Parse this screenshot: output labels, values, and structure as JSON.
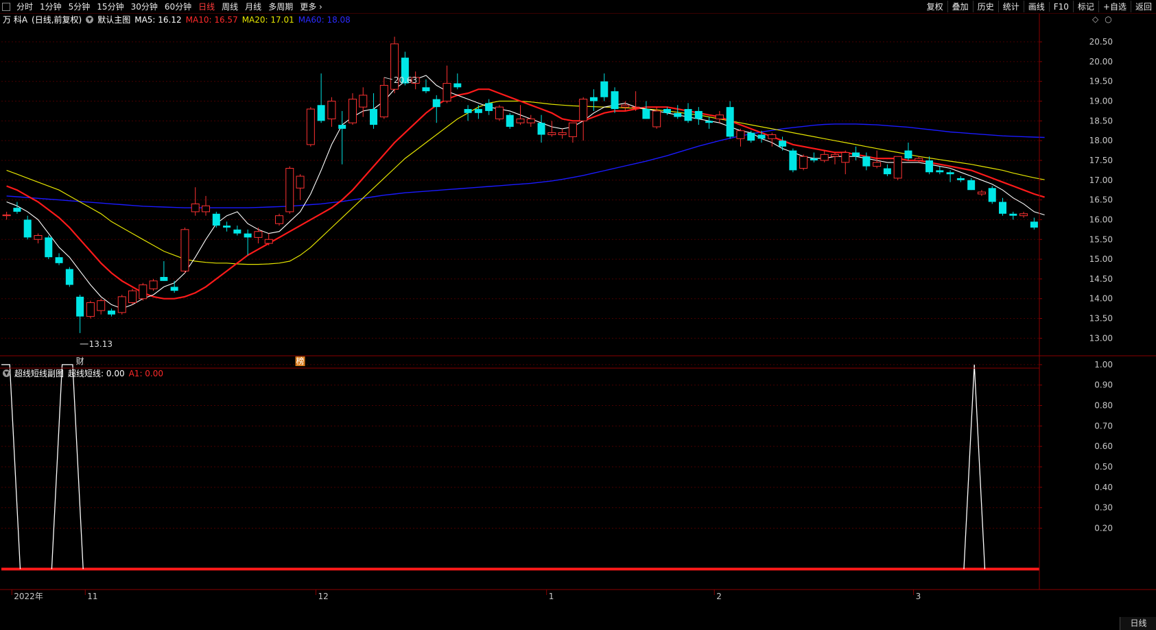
{
  "toolbar": {
    "tabs": [
      "分时",
      "1分钟",
      "5分钟",
      "15分钟",
      "30分钟",
      "60分钟",
      "日线",
      "周线",
      "月线",
      "多周期",
      "更多"
    ],
    "active_tab": "日线",
    "right_buttons": [
      "复权",
      "叠加",
      "历史",
      "统计",
      "画线",
      "F10",
      "标记",
      "+自选",
      "返回"
    ]
  },
  "main_info": {
    "stock": "万 科A",
    "mode": "(日线,前复权)",
    "chart_name": "默认主图",
    "ma5_label": "MA5: 16.12",
    "ma10_label": "MA10: 16.57",
    "ma20_label": "MA20: 17.01",
    "ma60_label": "MA60: 18.08"
  },
  "sub_info": {
    "name": "超线短线副图",
    "line_label": "超线短线: 0.00",
    "a1_label": "A1: 0.00"
  },
  "bottom_tab": "日线",
  "colors": {
    "up": "#ff3232",
    "down": "#00e6e6",
    "ma5": "#ffffff",
    "ma10": "#ff1a1a",
    "ma20": "#e6e600",
    "ma60": "#1a1aff",
    "grid": "#4a0000",
    "axis": "#8a0000"
  },
  "chart_data": {
    "type": "candlestick",
    "y_ticks": [
      20.5,
      20.0,
      19.5,
      19.0,
      18.5,
      18.0,
      17.5,
      17.0,
      16.5,
      16.0,
      15.5,
      15.0,
      14.5,
      14.0,
      13.5,
      13.0
    ],
    "y_tick_labels": [
      "20.50",
      "20.00",
      "19.50",
      "19.00",
      "18.50",
      "18.00",
      "17.50",
      "17.00",
      "16.50",
      "16.00",
      "15.50",
      "15.00",
      "14.50",
      "14.00",
      "13.50",
      "13.00"
    ],
    "ylim": [
      12.85,
      20.9
    ],
    "x_labels": [
      {
        "label": "2022年",
        "index": 1
      },
      {
        "label": "11",
        "index": 8
      },
      {
        "label": "12",
        "index": 30
      },
      {
        "label": "1",
        "index": 52
      },
      {
        "label": "2",
        "index": 68
      },
      {
        "label": "3",
        "index": 87
      }
    ],
    "annotations": {
      "high": "20.63",
      "low": "13.13",
      "high_index": 36,
      "low_index": 7,
      "marks": [
        {
          "text": "财",
          "index": 7
        },
        {
          "text": "榜",
          "index": 28
        }
      ]
    },
    "candles": [
      {
        "o": 16.1,
        "h": 16.2,
        "l": 16.0,
        "c": 16.12
      },
      {
        "o": 16.3,
        "h": 16.45,
        "l": 16.15,
        "c": 16.2
      },
      {
        "o": 16.0,
        "h": 16.1,
        "l": 15.5,
        "c": 15.55
      },
      {
        "o": 15.5,
        "h": 15.65,
        "l": 15.4,
        "c": 15.6
      },
      {
        "o": 15.55,
        "h": 15.6,
        "l": 15.0,
        "c": 15.05
      },
      {
        "o": 15.05,
        "h": 15.15,
        "l": 14.85,
        "c": 14.9
      },
      {
        "o": 14.75,
        "h": 14.8,
        "l": 14.3,
        "c": 14.35
      },
      {
        "o": 14.05,
        "h": 14.1,
        "l": 13.13,
        "c": 13.55
      },
      {
        "o": 13.55,
        "h": 13.95,
        "l": 13.5,
        "c": 13.9
      },
      {
        "o": 13.7,
        "h": 14.0,
        "l": 13.6,
        "c": 13.95
      },
      {
        "o": 13.7,
        "h": 13.75,
        "l": 13.55,
        "c": 13.6
      },
      {
        "o": 13.65,
        "h": 14.1,
        "l": 13.6,
        "c": 14.05
      },
      {
        "o": 13.9,
        "h": 14.25,
        "l": 13.85,
        "c": 14.2
      },
      {
        "o": 14.0,
        "h": 14.4,
        "l": 13.95,
        "c": 14.35
      },
      {
        "o": 14.25,
        "h": 14.5,
        "l": 14.2,
        "c": 14.45
      },
      {
        "o": 14.55,
        "h": 14.95,
        "l": 14.45,
        "c": 14.45
      },
      {
        "o": 14.3,
        "h": 14.45,
        "l": 14.15,
        "c": 14.2
      },
      {
        "o": 14.7,
        "h": 15.8,
        "l": 14.65,
        "c": 15.75
      },
      {
        "o": 16.2,
        "h": 16.82,
        "l": 16.1,
        "c": 16.4
      },
      {
        "o": 16.2,
        "h": 16.6,
        "l": 16.1,
        "c": 16.35
      },
      {
        "o": 16.15,
        "h": 16.2,
        "l": 15.8,
        "c": 15.85
      },
      {
        "o": 15.85,
        "h": 15.95,
        "l": 15.7,
        "c": 15.8
      },
      {
        "o": 15.75,
        "h": 15.85,
        "l": 15.6,
        "c": 15.65
      },
      {
        "o": 15.65,
        "h": 15.75,
        "l": 15.1,
        "c": 15.55
      },
      {
        "o": 15.55,
        "h": 15.8,
        "l": 15.4,
        "c": 15.7
      },
      {
        "o": 15.4,
        "h": 15.65,
        "l": 15.35,
        "c": 15.5
      },
      {
        "o": 15.9,
        "h": 16.15,
        "l": 15.85,
        "c": 16.1
      },
      {
        "o": 16.2,
        "h": 17.35,
        "l": 16.15,
        "c": 17.3
      },
      {
        "o": 16.8,
        "h": 17.15,
        "l": 16.5,
        "c": 17.1
      },
      {
        "o": 17.9,
        "h": 18.85,
        "l": 17.85,
        "c": 18.8
      },
      {
        "o": 18.9,
        "h": 19.7,
        "l": 18.45,
        "c": 18.5
      },
      {
        "o": 18.55,
        "h": 19.1,
        "l": 18.35,
        "c": 19.0
      },
      {
        "o": 18.4,
        "h": 18.75,
        "l": 17.4,
        "c": 18.3
      },
      {
        "o": 18.45,
        "h": 19.2,
        "l": 18.4,
        "c": 19.05
      },
      {
        "o": 18.85,
        "h": 19.35,
        "l": 18.6,
        "c": 19.15
      },
      {
        "o": 18.8,
        "h": 19.2,
        "l": 18.3,
        "c": 18.4
      },
      {
        "o": 18.6,
        "h": 19.6,
        "l": 18.55,
        "c": 19.4
      },
      {
        "o": 19.3,
        "h": 20.63,
        "l": 19.2,
        "c": 20.45
      },
      {
        "o": 20.1,
        "h": 20.25,
        "l": 19.4,
        "c": 19.45
      },
      {
        "o": 19.45,
        "h": 19.75,
        "l": 19.3,
        "c": 19.6
      },
      {
        "o": 19.35,
        "h": 19.55,
        "l": 19.2,
        "c": 19.25
      },
      {
        "o": 19.05,
        "h": 19.15,
        "l": 18.45,
        "c": 18.85
      },
      {
        "o": 19.0,
        "h": 19.9,
        "l": 18.95,
        "c": 19.45
      },
      {
        "o": 19.45,
        "h": 19.7,
        "l": 19.3,
        "c": 19.35
      },
      {
        "o": 18.8,
        "h": 18.9,
        "l": 18.5,
        "c": 18.7
      },
      {
        "o": 18.8,
        "h": 18.9,
        "l": 18.55,
        "c": 18.7
      },
      {
        "o": 18.95,
        "h": 19.05,
        "l": 18.65,
        "c": 18.75
      },
      {
        "o": 18.55,
        "h": 18.9,
        "l": 18.5,
        "c": 18.85
      },
      {
        "o": 18.65,
        "h": 18.7,
        "l": 18.3,
        "c": 18.35
      },
      {
        "o": 18.45,
        "h": 18.9,
        "l": 18.4,
        "c": 18.55
      },
      {
        "o": 18.45,
        "h": 18.65,
        "l": 18.35,
        "c": 18.55
      },
      {
        "o": 18.45,
        "h": 18.65,
        "l": 17.95,
        "c": 18.15
      },
      {
        "o": 18.15,
        "h": 18.5,
        "l": 18.1,
        "c": 18.2
      },
      {
        "o": 18.15,
        "h": 18.3,
        "l": 18.05,
        "c": 18.2
      },
      {
        "o": 18.1,
        "h": 18.45,
        "l": 17.95,
        "c": 18.45
      },
      {
        "o": 18.5,
        "h": 19.1,
        "l": 18.0,
        "c": 19.05
      },
      {
        "o": 19.1,
        "h": 19.3,
        "l": 18.75,
        "c": 19.0
      },
      {
        "o": 19.5,
        "h": 19.7,
        "l": 19.0,
        "c": 19.1
      },
      {
        "o": 19.25,
        "h": 19.35,
        "l": 18.7,
        "c": 18.8
      },
      {
        "o": 18.85,
        "h": 19.0,
        "l": 18.75,
        "c": 18.9
      },
      {
        "o": 18.85,
        "h": 19.25,
        "l": 18.75,
        "c": 18.85
      },
      {
        "o": 18.8,
        "h": 19.0,
        "l": 18.55,
        "c": 18.55
      },
      {
        "o": 18.35,
        "h": 18.85,
        "l": 18.3,
        "c": 18.75
      },
      {
        "o": 18.8,
        "h": 18.85,
        "l": 18.65,
        "c": 18.7
      },
      {
        "o": 18.7,
        "h": 18.9,
        "l": 18.55,
        "c": 18.6
      },
      {
        "o": 18.8,
        "h": 18.95,
        "l": 18.45,
        "c": 18.5
      },
      {
        "o": 18.75,
        "h": 18.85,
        "l": 18.4,
        "c": 18.55
      },
      {
        "o": 18.5,
        "h": 18.6,
        "l": 18.3,
        "c": 18.45
      },
      {
        "o": 18.55,
        "h": 18.75,
        "l": 18.45,
        "c": 18.65
      },
      {
        "o": 18.85,
        "h": 19.0,
        "l": 18.05,
        "c": 18.1
      },
      {
        "o": 18.05,
        "h": 18.3,
        "l": 17.85,
        "c": 18.25
      },
      {
        "o": 18.2,
        "h": 18.25,
        "l": 17.95,
        "c": 18.0
      },
      {
        "o": 18.15,
        "h": 18.25,
        "l": 17.95,
        "c": 18.05
      },
      {
        "o": 18.05,
        "h": 18.2,
        "l": 17.85,
        "c": 18.15
      },
      {
        "o": 18.0,
        "h": 18.1,
        "l": 17.75,
        "c": 17.85
      },
      {
        "o": 17.75,
        "h": 17.8,
        "l": 17.2,
        "c": 17.25
      },
      {
        "o": 17.3,
        "h": 17.65,
        "l": 17.25,
        "c": 17.6
      },
      {
        "o": 17.55,
        "h": 17.7,
        "l": 17.45,
        "c": 17.5
      },
      {
        "o": 17.5,
        "h": 17.75,
        "l": 17.45,
        "c": 17.65
      },
      {
        "o": 17.6,
        "h": 17.7,
        "l": 17.4,
        "c": 17.65
      },
      {
        "o": 17.45,
        "h": 17.75,
        "l": 17.15,
        "c": 17.7
      },
      {
        "o": 17.7,
        "h": 17.85,
        "l": 17.5,
        "c": 17.6
      },
      {
        "o": 17.6,
        "h": 17.7,
        "l": 17.25,
        "c": 17.35
      },
      {
        "o": 17.35,
        "h": 17.75,
        "l": 17.3,
        "c": 17.45
      },
      {
        "o": 17.3,
        "h": 17.4,
        "l": 17.1,
        "c": 17.15
      },
      {
        "o": 17.05,
        "h": 17.6,
        "l": 17.0,
        "c": 17.6
      },
      {
        "o": 17.75,
        "h": 17.95,
        "l": 17.5,
        "c": 17.55
      },
      {
        "o": 17.5,
        "h": 17.6,
        "l": 17.45,
        "c": 17.55
      },
      {
        "o": 17.5,
        "h": 17.6,
        "l": 17.15,
        "c": 17.2
      },
      {
        "o": 17.25,
        "h": 17.35,
        "l": 17.15,
        "c": 17.2
      },
      {
        "o": 17.2,
        "h": 17.25,
        "l": 16.95,
        "c": 17.15
      },
      {
        "o": 17.05,
        "h": 17.1,
        "l": 16.95,
        "c": 17.0
      },
      {
        "o": 17.0,
        "h": 17.05,
        "l": 16.75,
        "c": 16.75
      },
      {
        "o": 16.65,
        "h": 16.75,
        "l": 16.6,
        "c": 16.7
      },
      {
        "o": 16.8,
        "h": 16.85,
        "l": 16.4,
        "c": 16.45
      },
      {
        "o": 16.45,
        "h": 16.55,
        "l": 16.1,
        "c": 16.15
      },
      {
        "o": 16.15,
        "h": 16.2,
        "l": 16.0,
        "c": 16.1
      },
      {
        "o": 16.1,
        "h": 16.2,
        "l": 16.05,
        "c": 16.15
      },
      {
        "o": 15.95,
        "h": 16.05,
        "l": 15.75,
        "c": 15.8
      }
    ],
    "ma5": [
      16.45,
      16.35,
      16.2,
      16.0,
      15.65,
      15.3,
      15.05,
      14.7,
      14.35,
      14.05,
      13.85,
      13.75,
      13.85,
      14.0,
      14.1,
      14.3,
      14.4,
      14.65,
      15.05,
      15.5,
      15.9,
      16.1,
      16.2,
      15.9,
      15.75,
      15.65,
      15.7,
      15.95,
      16.2,
      16.65,
      17.25,
      17.9,
      18.4,
      18.6,
      18.75,
      18.8,
      19.0,
      19.3,
      19.5,
      19.55,
      19.65,
      19.4,
      19.25,
      19.15,
      19.05,
      18.95,
      18.85,
      18.8,
      18.75,
      18.65,
      18.55,
      18.45,
      18.35,
      18.3,
      18.35,
      18.5,
      18.7,
      18.85,
      18.9,
      18.95,
      18.85,
      18.8,
      18.75,
      18.7,
      18.65,
      18.6,
      18.55,
      18.5,
      18.45,
      18.35,
      18.25,
      18.2,
      18.05,
      17.95,
      17.8,
      17.7,
      17.6,
      17.55,
      17.55,
      17.6,
      17.6,
      17.6,
      17.55,
      17.5,
      17.45,
      17.45,
      17.45,
      17.45,
      17.4,
      17.35,
      17.3,
      17.2,
      17.1,
      17.0,
      16.9,
      16.75,
      16.55,
      16.4,
      16.2,
      16.12
    ],
    "ma10": [
      16.85,
      16.75,
      16.6,
      16.45,
      16.25,
      16.05,
      15.8,
      15.5,
      15.2,
      14.9,
      14.65,
      14.45,
      14.3,
      14.15,
      14.05,
      14.0,
      14.0,
      14.05,
      14.15,
      14.3,
      14.5,
      14.7,
      14.9,
      15.1,
      15.25,
      15.4,
      15.55,
      15.7,
      15.85,
      16.0,
      16.15,
      16.3,
      16.5,
      16.75,
      17.05,
      17.35,
      17.65,
      17.95,
      18.2,
      18.45,
      18.7,
      18.9,
      19.05,
      19.15,
      19.2,
      19.3,
      19.3,
      19.2,
      19.1,
      19.0,
      18.9,
      18.8,
      18.7,
      18.55,
      18.5,
      18.5,
      18.6,
      18.7,
      18.75,
      18.75,
      18.8,
      18.85,
      18.85,
      18.85,
      18.8,
      18.75,
      18.7,
      18.65,
      18.6,
      18.5,
      18.4,
      18.3,
      18.2,
      18.1,
      18.0,
      17.9,
      17.85,
      17.8,
      17.75,
      17.7,
      17.7,
      17.65,
      17.6,
      17.55,
      17.55,
      17.55,
      17.5,
      17.5,
      17.45,
      17.4,
      17.35,
      17.3,
      17.25,
      17.15,
      17.05,
      16.95,
      16.85,
      16.75,
      16.65,
      16.57
    ],
    "ma20": [
      17.25,
      17.15,
      17.05,
      16.95,
      16.85,
      16.75,
      16.6,
      16.45,
      16.3,
      16.15,
      15.95,
      15.8,
      15.65,
      15.5,
      15.35,
      15.2,
      15.1,
      15.0,
      14.95,
      14.92,
      14.9,
      14.9,
      14.88,
      14.87,
      14.87,
      14.88,
      14.9,
      14.95,
      15.1,
      15.3,
      15.55,
      15.8,
      16.05,
      16.3,
      16.55,
      16.8,
      17.05,
      17.3,
      17.55,
      17.75,
      17.95,
      18.15,
      18.35,
      18.55,
      18.7,
      18.85,
      18.95,
      19.0,
      19.0,
      19.0,
      18.98,
      18.95,
      18.92,
      18.9,
      18.88,
      18.87,
      18.86,
      18.85,
      18.84,
      18.83,
      18.82,
      18.8,
      18.78,
      18.75,
      18.72,
      18.68,
      18.65,
      18.6,
      18.55,
      18.5,
      18.45,
      18.4,
      18.35,
      18.3,
      18.25,
      18.2,
      18.15,
      18.1,
      18.05,
      18.0,
      17.95,
      17.9,
      17.85,
      17.8,
      17.75,
      17.7,
      17.65,
      17.6,
      17.56,
      17.52,
      17.48,
      17.44,
      17.4,
      17.35,
      17.3,
      17.25,
      17.18,
      17.12,
      17.06,
      17.01
    ],
    "ma60": [
      16.6,
      16.58,
      16.56,
      16.54,
      16.52,
      16.5,
      16.48,
      16.46,
      16.44,
      16.42,
      16.4,
      16.38,
      16.36,
      16.34,
      16.33,
      16.32,
      16.31,
      16.3,
      16.3,
      16.3,
      16.3,
      16.3,
      16.3,
      16.3,
      16.31,
      16.32,
      16.33,
      16.34,
      16.36,
      16.38,
      16.4,
      16.43,
      16.46,
      16.5,
      16.54,
      16.58,
      16.62,
      16.65,
      16.68,
      16.7,
      16.72,
      16.74,
      16.76,
      16.78,
      16.8,
      16.82,
      16.84,
      16.86,
      16.88,
      16.9,
      16.92,
      16.95,
      16.98,
      17.02,
      17.07,
      17.12,
      17.18,
      17.24,
      17.3,
      17.36,
      17.42,
      17.48,
      17.55,
      17.62,
      17.7,
      17.78,
      17.86,
      17.93,
      18.0,
      18.06,
      18.12,
      18.17,
      18.22,
      18.26,
      18.3,
      18.33,
      18.36,
      18.39,
      18.41,
      18.42,
      18.42,
      18.42,
      18.41,
      18.4,
      18.38,
      18.36,
      18.34,
      18.31,
      18.28,
      18.25,
      18.22,
      18.2,
      18.18,
      18.16,
      18.14,
      18.12,
      18.11,
      18.1,
      18.09,
      18.08
    ],
    "sub": {
      "y_ticks": [
        1.0,
        0.9,
        0.8,
        0.7,
        0.6,
        0.5,
        0.4,
        0.3,
        0.2
      ],
      "y_tick_labels": [
        "1.00",
        "0.90",
        "0.80",
        "0.70",
        "0.60",
        "0.50",
        "0.40",
        "0.30",
        "0.20"
      ],
      "ylim": [
        -0.05,
        1.05
      ],
      "spikes": [
        {
          "x": [
            -0.5,
            0.3,
            1.3
          ],
          "y": [
            1.0,
            1.0,
            0.0
          ]
        },
        {
          "x": [
            4.3,
            5.3,
            6.3,
            7.3
          ],
          "y": [
            0.0,
            1.0,
            1.0,
            0.0
          ]
        },
        {
          "x": [
            91.3,
            92.3,
            93.3
          ],
          "y": [
            0.0,
            1.0,
            0.0
          ]
        }
      ],
      "a1_value": 0.0
    }
  }
}
